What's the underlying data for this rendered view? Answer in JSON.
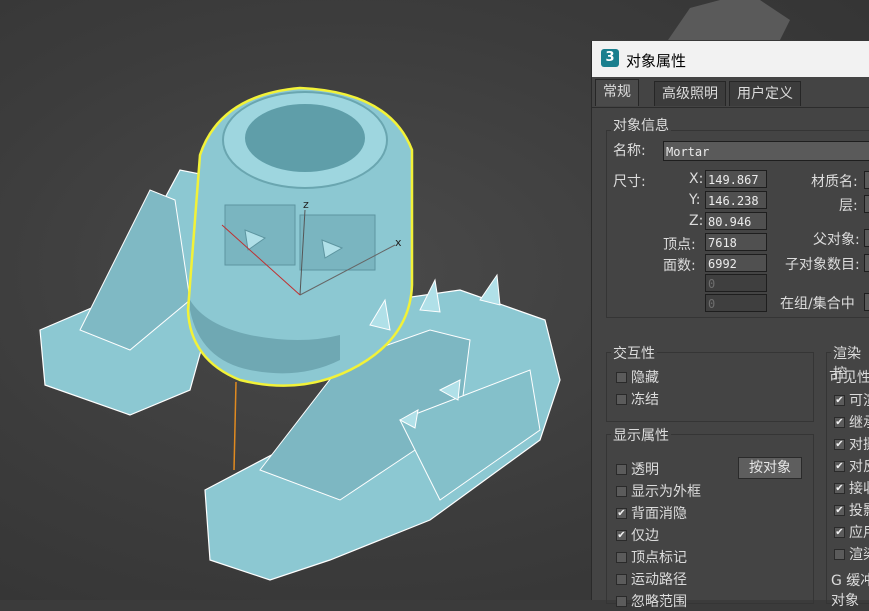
{
  "dialog": {
    "title": "对象属性",
    "logo_text": "3",
    "tabs": [
      "常规",
      "高级照明",
      "用户定义"
    ]
  },
  "object_info": {
    "group_label": "对象信息",
    "name_label": "名称:",
    "name_value": "Mortar",
    "size_label": "尺寸:",
    "x_label": "X:",
    "x_value": "149.867",
    "y_label": "Y:",
    "y_value": "146.238",
    "z_label": "Z:",
    "z_value": "80.946",
    "vertices_label": "顶点:",
    "vertices_value": "7618",
    "faces_label": "面数:",
    "faces_value": "6992",
    "extra1_value": "0",
    "extra2_value": "0",
    "material_label": "材质名:",
    "layer_label": "层:",
    "parent_label": "父对象:",
    "children_label": "子对象数目:",
    "in_group_label": "在组/集合中"
  },
  "interactivity": {
    "group_label": "交互性",
    "hide_label": "隐藏",
    "freeze_label": "冻结"
  },
  "display": {
    "group_label": "显示属性",
    "by_object_button": "按对象",
    "items": [
      {
        "label": "透明",
        "checked": false
      },
      {
        "label": "显示为外框",
        "checked": false
      },
      {
        "label": "背面消隐",
        "checked": true
      },
      {
        "label": "仅边",
        "checked": true
      },
      {
        "label": "顶点标记",
        "checked": false
      },
      {
        "label": "运动路径",
        "checked": false
      },
      {
        "label": "忽略范围",
        "checked": false
      }
    ]
  },
  "render": {
    "group_label": "渲染控",
    "visibility_label": "可见性",
    "items": [
      {
        "label": "可渲",
        "checked": true
      },
      {
        "label": "继承",
        "checked": true
      },
      {
        "label": "对摄",
        "checked": true
      },
      {
        "label": "对反",
        "checked": true
      },
      {
        "label": "接收",
        "checked": true
      },
      {
        "label": "投影",
        "checked": true
      },
      {
        "label": "应用",
        "checked": true
      },
      {
        "label": "渲染",
        "checked": false
      }
    ],
    "gbuffer_label": "G 缓冲",
    "object_label": "对象"
  },
  "viewport": {
    "axis_x": "x",
    "axis_z": "z",
    "model_color": "#8cc8d2",
    "selection_color": "#f2f238"
  }
}
